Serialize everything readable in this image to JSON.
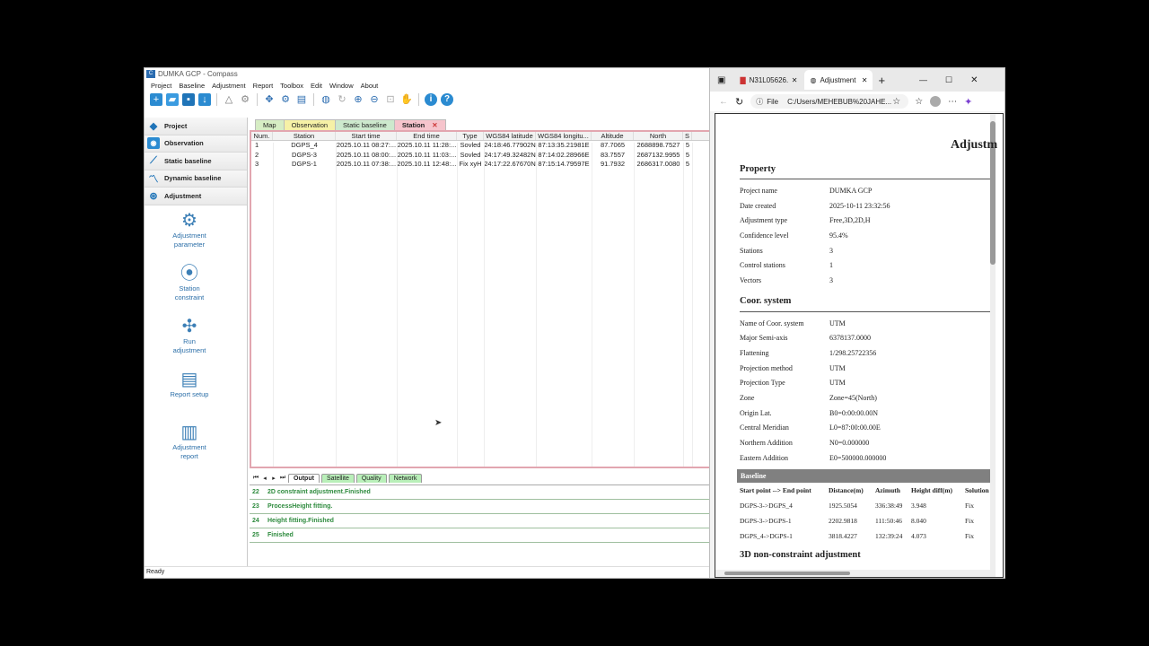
{
  "app": {
    "title": "DUMKA GCP - Compass",
    "menu": [
      "Project",
      "Baseline",
      "Adjustment",
      "Report",
      "Toolbox",
      "Edit",
      "Window",
      "About"
    ]
  },
  "sidebar": {
    "items": [
      "Project",
      "Observation",
      "Static baseline",
      "Dynamic baseline",
      "Adjustment"
    ],
    "tools": [
      {
        "label": "Adjustment parameter",
        "icon": "gear-icon"
      },
      {
        "label": "Station constraint",
        "icon": "pin-icon"
      },
      {
        "label": "Run adjustment",
        "icon": "network-icon"
      },
      {
        "label": "Report setup",
        "icon": "report-icon"
      },
      {
        "label": "Adjustment report",
        "icon": "report-search-icon"
      }
    ]
  },
  "tabs": [
    {
      "label": "Map",
      "color": "#d6edc4"
    },
    {
      "label": "Observation",
      "color": "#f6f1a6"
    },
    {
      "label": "Static baseline",
      "color": "#cde9cd"
    },
    {
      "label": "Station",
      "color": "#f6c4cc"
    }
  ],
  "table": {
    "headers": [
      "Num.",
      "Station",
      "Start time",
      "End time",
      "Type",
      "WGS84 latitude",
      "WGS84 longitu...",
      "Altitude",
      "North",
      "S"
    ],
    "rows": [
      [
        "1",
        "DGPS_4",
        "2025.10.11 08:27:...",
        "2025.10.11 11:28:...",
        "Sovled",
        "24:18:46.77902N",
        "87:13:35.21981E",
        "87.7065",
        "2688898.7527",
        "5"
      ],
      [
        "2",
        "DGPS-3",
        "2025.10.11 08:00:...",
        "2025.10.11 11:03:...",
        "Sovled",
        "24:17:49.32482N",
        "87:14:02.28966E",
        "83.7557",
        "2687132.9955",
        "5"
      ],
      [
        "3",
        "DGPS-1",
        "2025.10.11 07:38:...",
        "2025.10.11 12:48:...",
        "Fix xyH",
        "24:17:22.67670N",
        "87:15:14.79597E",
        "91.7932",
        "2686317.0080",
        "5"
      ]
    ]
  },
  "output": {
    "tabs": [
      "Output",
      "Satellite",
      "Quality",
      "Network"
    ],
    "rows": [
      {
        "n": "22",
        "text": "2D constraint adjustment.Finished"
      },
      {
        "n": "23",
        "text": "ProcessHeight fitting."
      },
      {
        "n": "24",
        "text": "Height fitting.Finished"
      },
      {
        "n": "25",
        "text": "Finished"
      }
    ]
  },
  "status": "Ready",
  "browser": {
    "tab1": "N31L05626...",
    "tab2": "Adjustment",
    "url_prefix": "File",
    "url": "C:/Users/MEHEBUB%20JAHE..."
  },
  "report": {
    "title": "Adjustm",
    "property_title": "Property",
    "property": [
      [
        "Project name",
        "DUMKA GCP"
      ],
      [
        "Date created",
        "2025-10-11 23:32:56"
      ],
      [
        "Adjustment type",
        "Free,3D,2D,H"
      ],
      [
        "Confidence level",
        "95.4%"
      ],
      [
        "Stations",
        "3"
      ],
      [
        "Control stations",
        "1"
      ],
      [
        "Vectors",
        "3"
      ]
    ],
    "coor_title": "Coor. system",
    "coor": [
      [
        "Name of Coor. system",
        "UTM"
      ],
      [
        "Major Semi-axis",
        "6378137.0000"
      ],
      [
        "Flattening",
        "1/298.25722356"
      ],
      [
        "Projection method",
        "UTM"
      ],
      [
        "Projection Type",
        "UTM"
      ],
      [
        "Zone",
        "Zone=45(North)"
      ],
      [
        "Origin Lat.",
        "B0=0:00:00.00N"
      ],
      [
        "Central Meridian",
        "L0=87:00:00.00E"
      ],
      [
        "Northern Addition",
        "N0=0.000000"
      ],
      [
        "Eastern Addition",
        "E0=500000.000000"
      ]
    ],
    "baseline_title": "Baseline",
    "baseline_headers": [
      "Start point --> End point",
      "Distance(m)",
      "Azimuth",
      "Height diff(m)",
      "Solution"
    ],
    "baseline": [
      [
        "DGPS-3->DGPS_4",
        "1925.5054",
        "336:38:49",
        "3.948",
        "Fix"
      ],
      [
        "DGPS-3->DGPS-1",
        "2202.9818",
        "111:50:46",
        "8.040",
        "Fix"
      ],
      [
        "DGPS_4->DGPS-1",
        "3818.4227",
        "132:39:24",
        "4.073",
        "Fix"
      ]
    ],
    "next_title": "3D non-constraint adjustment"
  }
}
